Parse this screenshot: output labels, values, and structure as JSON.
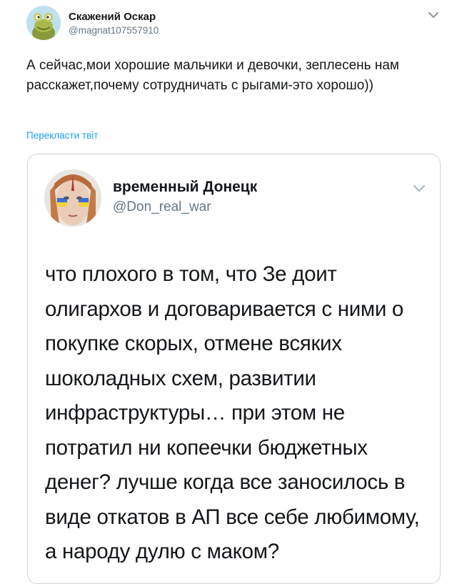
{
  "tweet": {
    "author_name": "Скажений Оскар",
    "author_handle": "@magnat107557910",
    "text": "А сейчас,мои хорошие мальчики и девочки, зеплесень нам расскажет,почему сотрудничать с рыгами-это хорошо))",
    "translate_label": "Перекласти твіт",
    "avatar_icon": "frog-cartoon-avatar",
    "menu_icon": "chevron-down-icon"
  },
  "quoted_tweet": {
    "author_name": "временный Донецк",
    "author_handle": "@Don_real_war",
    "avatar_icon": "face-portrait-avatar",
    "menu_icon": "chevron-down-icon",
    "image_text": "что плохого в том, что Зе доит олигархов и договаривается с ними о покупке скорых, отмене всяких шоколадных схем, развитии инфраструктуры… при этом не потратил ни копеечки бюджетных денег? лучше когда все заносилось в виде откатов в АП все себе любимому, а народу дулю с маком?"
  },
  "colors": {
    "text": "#14171a",
    "secondary": "#657786",
    "link": "#1da1f2",
    "border": "#ccd6dd"
  }
}
